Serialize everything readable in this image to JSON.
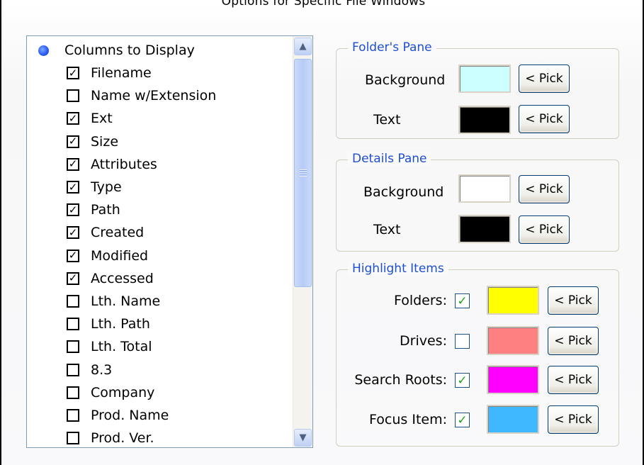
{
  "window": {
    "title": "Options for Specific File Windows"
  },
  "columns": {
    "root_label": "Columns to Display",
    "items": [
      {
        "label": "Filename",
        "checked": true
      },
      {
        "label": "Name w/Extension",
        "checked": false
      },
      {
        "label": "Ext",
        "checked": true
      },
      {
        "label": "Size",
        "checked": true
      },
      {
        "label": "Attributes",
        "checked": true
      },
      {
        "label": "Type",
        "checked": true
      },
      {
        "label": "Path",
        "checked": true
      },
      {
        "label": "Created",
        "checked": true
      },
      {
        "label": "Modified",
        "checked": true
      },
      {
        "label": "Accessed",
        "checked": true
      },
      {
        "label": "Lth. Name",
        "checked": false
      },
      {
        "label": "Lth. Path",
        "checked": false
      },
      {
        "label": "Lth. Total",
        "checked": false
      },
      {
        "label": "8.3",
        "checked": false
      },
      {
        "label": "Company",
        "checked": false
      },
      {
        "label": "Prod. Name",
        "checked": false
      },
      {
        "label": "Prod. Ver.",
        "checked": false
      }
    ]
  },
  "folders_pane": {
    "title": "Folder's Pane",
    "background_label": "Background",
    "background_color": "#ccffff",
    "text_label": "Text",
    "text_color": "#000000",
    "pick_label": "< Pick"
  },
  "details_pane": {
    "title": "Details Pane",
    "background_label": "Background",
    "background_color": "#ffffff",
    "text_label": "Text",
    "text_color": "#000000",
    "pick_label": "< Pick"
  },
  "highlight": {
    "title": "Highlight Items",
    "pick_label": "< Pick",
    "items": [
      {
        "label": "Folders:",
        "checked": true,
        "color": "#ffff00"
      },
      {
        "label": "Drives:",
        "checked": false,
        "color": "#ff8080"
      },
      {
        "label": "Search Roots:",
        "checked": true,
        "color": "#ff00ff"
      },
      {
        "label": "Focus Item:",
        "checked": true,
        "color": "#40b8ff"
      }
    ]
  }
}
